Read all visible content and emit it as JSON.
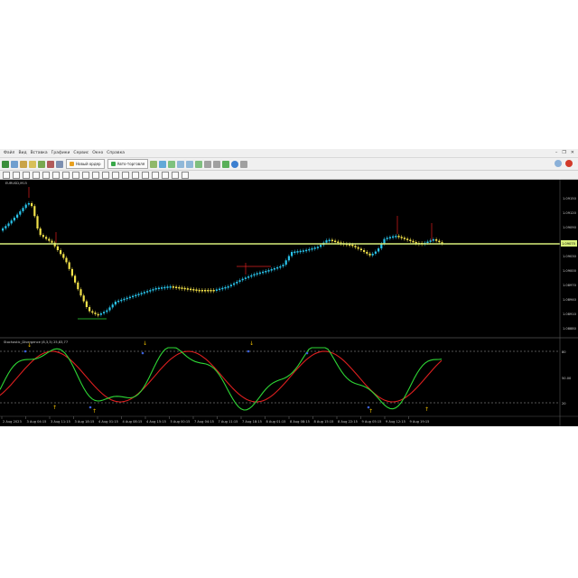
{
  "menu": [
    "Файл",
    "Вид",
    "Вставка",
    "Графики",
    "Сервис",
    "Окно",
    "Справка"
  ],
  "toolbar": {
    "new_order_label": "Новый ордер",
    "autotrading_label": "Авто-торговля"
  },
  "chart_window": {
    "main_title": "EURUSD,M15",
    "indicator_title": "Stochastic_Divergence (8,3,3) 25,83,77",
    "price_labels": [
      "1.09150",
      "1.09120",
      "1.09090",
      "1.09060",
      "1.09030",
      "1.09000",
      "1.08970",
      "1.08940",
      "1.08910",
      "1.08880"
    ],
    "current_price": "1.09075",
    "indicator_labels": [
      "80",
      "50.00",
      "20"
    ],
    "time_labels": [
      "2 Aug 2023",
      "3 Aug 04:15",
      "3 Aug 11:15",
      "3 Aug 18:15",
      "4 Aug 01:15",
      "4 Aug 08:15",
      "4 Aug 15:15",
      "5 Aug 00:15",
      "7 Aug 04:15",
      "7 Aug 11:15",
      "7 Aug 18:15",
      "8 Aug 01:15",
      "8 Aug 08:15",
      "8 Aug 15:15",
      "8 Aug 22:15",
      "9 Aug 05:15",
      "9 Aug 12:15",
      "9 Aug 19:15"
    ]
  },
  "colors": {
    "background": "#000000",
    "bull": "#29c3ea",
    "bear": "#f2e24a",
    "signal_line": "#d7ee7a",
    "osc_main": "#2ed635",
    "osc_signal": "#dd1f1f",
    "arrow_up": "#f0c000",
    "level_line": "#aaaaaa"
  }
}
